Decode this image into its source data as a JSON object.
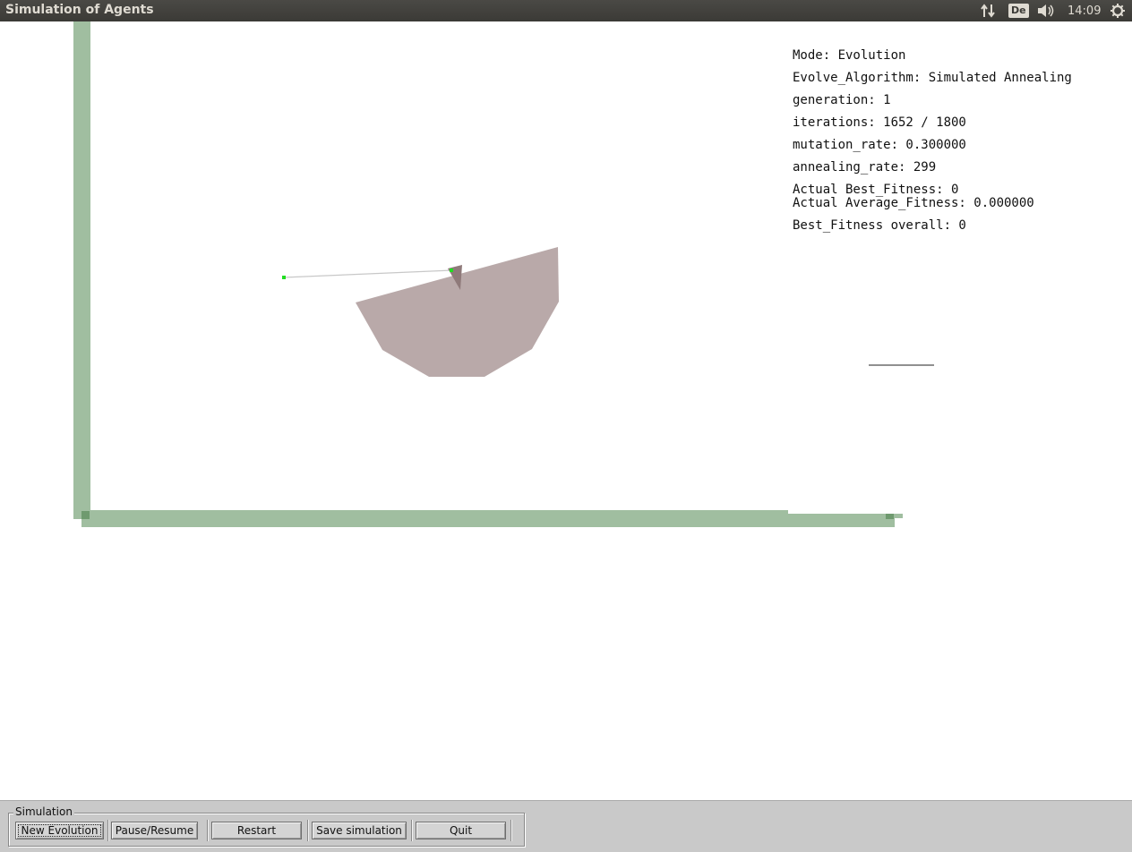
{
  "topbar": {
    "title": "Simulation of Agents",
    "keyboard_layout": "De",
    "time": "14:09",
    "icons": [
      "network-icon",
      "volume-icon",
      "power-icon"
    ]
  },
  "info": {
    "mode": "Mode: Evolution",
    "algorithm": "Evolve_Algorithm: Simulated Annealing",
    "generation": "generation: 1",
    "iterations": "iterations: 1652 / 1800",
    "mutation_rate": "mutation_rate: 0.300000",
    "annealing_rate": "annealing_rate: 299",
    "actual_best": "Actual Best_Fitness: 0",
    "actual_average": "Actual Average_Fitness: 0.000000",
    "best_overall": "Best_Fitness overall: 0"
  },
  "colors": {
    "wall": "#a0bea0",
    "agent_body": "#b9a9a9",
    "sensor_line": "#c8c8c8",
    "sensor_point": "#22dd22"
  },
  "panel": {
    "group_label": "Simulation",
    "buttons": {
      "new_evolution": "New Evolution",
      "pause_resume": "Pause/Resume",
      "restart": "Restart",
      "save_simulation": "Save simulation",
      "quit": "Quit"
    }
  }
}
